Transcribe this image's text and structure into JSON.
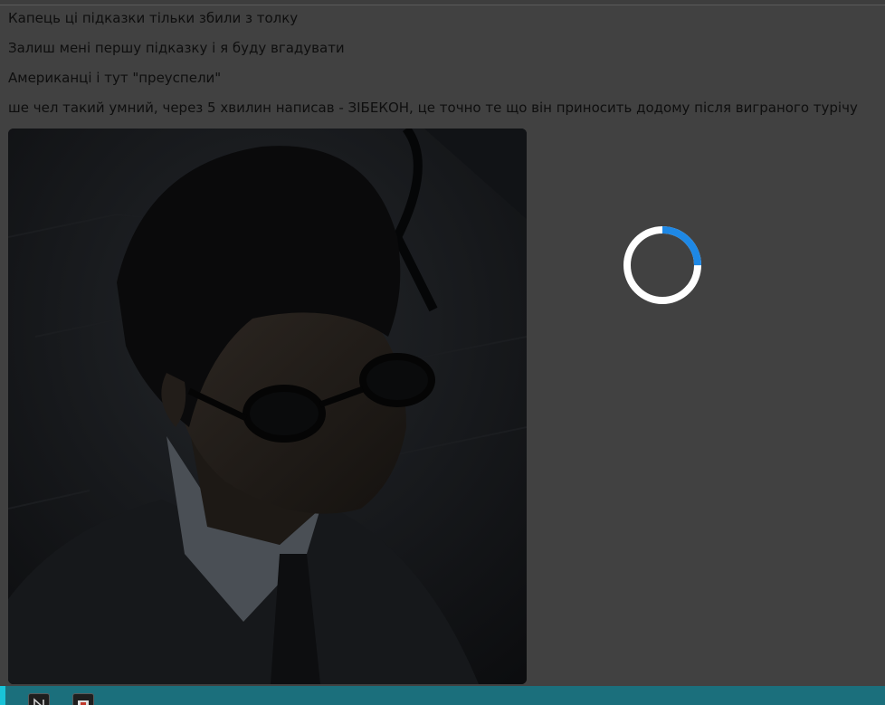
{
  "chat": {
    "messages": [
      "Капець ці підказки тільки збили з толку",
      "Залиш мені першу підказку і я буду вгадувати",
      "Американці і тут \"преуспели\"",
      "ше чел такий умний, через 5 хвилин написав - ЗІБЕКОН, це точно те що він приносить додому після виграного турічу"
    ]
  },
  "colors": {
    "overlay": "#414141",
    "spinner_track": "#ffffff",
    "spinner_accent": "#1e88e5",
    "taskbar": "#1b6f7c"
  },
  "spinner": {
    "progress": 0.25
  },
  "taskbar": {
    "icons": [
      "notion-icon",
      "app-icon"
    ]
  }
}
